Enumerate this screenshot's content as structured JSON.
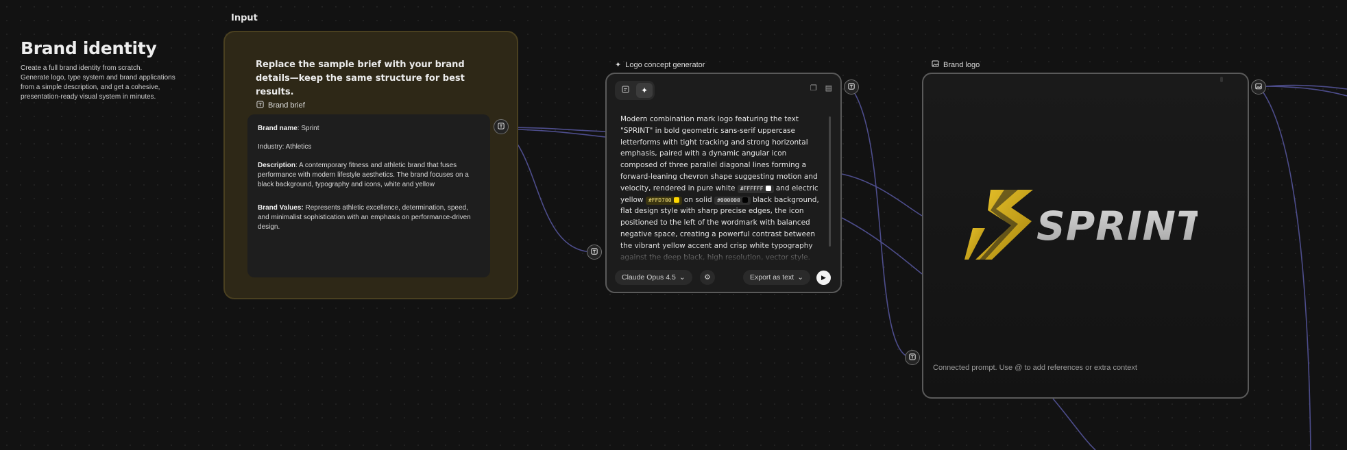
{
  "intro": {
    "title": "Brand identity",
    "line1": "Create a full brand identity from scratch.",
    "line2": "Generate logo, type system and brand applications from a simple description, and get a cohesive, presentation-ready visual system in minutes."
  },
  "input_group": {
    "label": "Input",
    "instructions": "Replace the sample brief with your brand details—keep the same structure for best results.",
    "brief_title": "Brand brief",
    "brief": {
      "name_label": "Brand name",
      "name_value": ": Sprint",
      "industry": "Industry: Athletics",
      "description_label": "Description",
      "description_value": ": A contemporary fitness and athletic brand that fuses performance with modern lifestyle aesthetics. The brand focuses on a black background, typography and icons, white and yellow",
      "values_label": "Brand Values:",
      "values_value": " Represents athletic excellence, determination, speed, and minimalist sophistication with an emphasis on performance-driven design."
    }
  },
  "generator": {
    "title": "Logo concept generator",
    "text_a": "Modern combination mark logo featuring the text \"SPRINT\" in bold geometric sans-serif uppercase letterforms with tight tracking and strong horizontal emphasis, paired with a dynamic angular icon composed of three parallel diagonal lines forming a forward-leaning chevron shape suggesting motion and velocity, rendered in pure white ",
    "chip_white": "#FFFFFF",
    "text_b": " and electric yellow ",
    "chip_yellow": "#FFD700",
    "text_c": " on solid ",
    "chip_black": "#000000",
    "text_d": " black background, flat design style with sharp precise edges, the icon positioned to the left of the wordmark with balanced negative space, creating a powerful contrast between the vibrant yellow accent and crisp white typography against the deep black, high resolution, vector style.",
    "model": "Claude Opus 4.5",
    "export": "Export as text"
  },
  "logo_node": {
    "title": "Brand logo",
    "wordmark": "SPRINT",
    "prompt_placeholder": "Connected prompt. Use @ to add references or extra context"
  },
  "colors": {
    "accent_yellow": "#FFD700",
    "white": "#FFFFFF",
    "black": "#000000",
    "wire": "#5a5aa0"
  },
  "icons": [
    "text-port-icon",
    "image-port-icon",
    "sparkle-icon",
    "copy-icon",
    "gear-icon",
    "play-icon",
    "chevron-down-icon"
  ]
}
